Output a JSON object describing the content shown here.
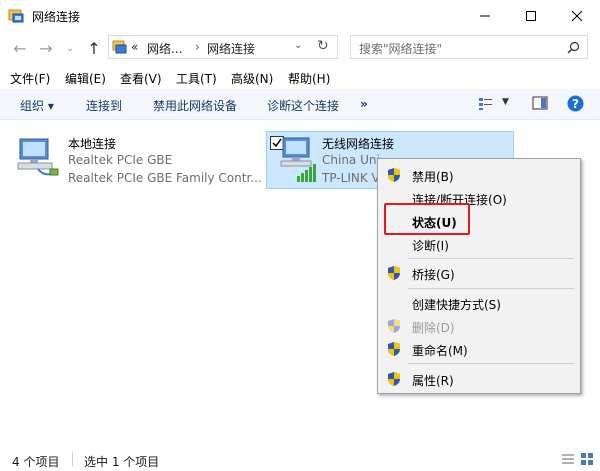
{
  "window": {
    "title": "网络连接",
    "minimize": "—",
    "maximize": "☐",
    "close": "✕"
  },
  "address": {
    "overflow": "«",
    "crumb1": "网络...",
    "crumb_sep": "›",
    "crumb2": "网络连接",
    "search_placeholder": "搜索\"网络连接\""
  },
  "menu": [
    "文件(F)",
    "编辑(E)",
    "查看(V)",
    "工具(T)",
    "高级(N)",
    "帮助(H)"
  ],
  "commands": {
    "organize": "组织 ▾",
    "connect": "连接到",
    "disable": "禁用此网络设备",
    "diagnose": "诊断这个连接",
    "more": "»"
  },
  "items": {
    "local": {
      "name": "本地连接",
      "line1": "Realtek PCIe GBE",
      "line2": "Realtek PCIe GBE Family Contr..."
    },
    "wireless": {
      "name": "无线网络连接",
      "line1": "China Uni",
      "line1_tail": "...",
      "line2": "TP-LINK V"
    }
  },
  "context_menu": [
    {
      "label": "禁用(B)",
      "shield": true,
      "disabled": false
    },
    {
      "label": "连接/断开连接(O)",
      "shield": false,
      "disabled": false
    },
    {
      "label": "状态(U)",
      "shield": false,
      "disabled": false,
      "bold": true
    },
    {
      "label": "诊断(I)",
      "shield": false,
      "disabled": false
    },
    {
      "label": "桥接(G)",
      "shield": true,
      "disabled": false
    },
    {
      "label": "创建快捷方式(S)",
      "shield": false,
      "disabled": false
    },
    {
      "label": "删除(D)",
      "shield": true,
      "disabled": true
    },
    {
      "label": "重命名(M)",
      "shield": true,
      "disabled": false
    },
    {
      "label": "属性(R)",
      "shield": true,
      "disabled": false
    }
  ],
  "status": {
    "count": "4 个项目",
    "selected": "选中 1 个项目"
  },
  "colors": {
    "selection": "#cce8ff",
    "highlight": "#e01c1c",
    "help_blue": "#1e6fd0"
  }
}
